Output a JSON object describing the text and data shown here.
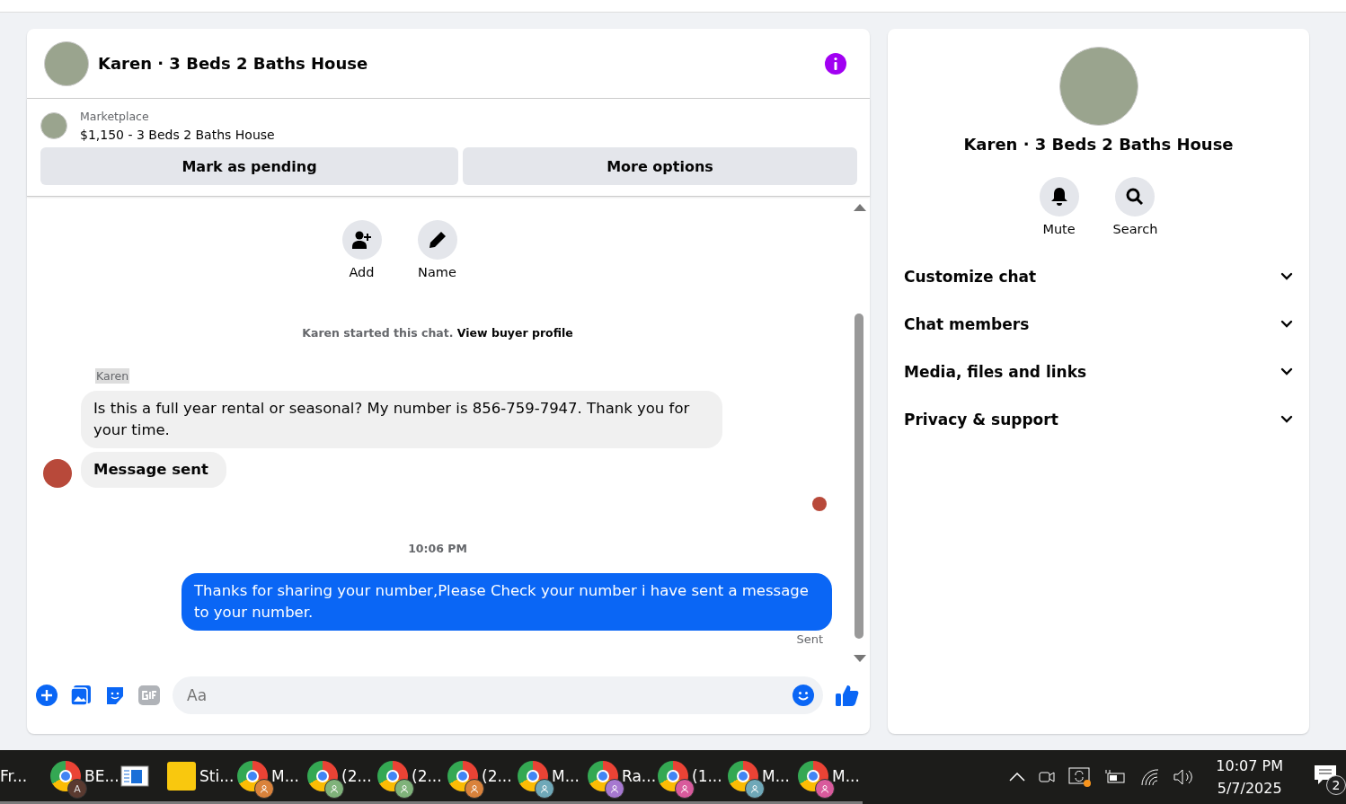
{
  "chat": {
    "title": "Karen · 3 Beds 2 Baths House",
    "listing": {
      "source": "Marketplace",
      "summary": "$1,150 - 3 Beds 2 Baths House"
    },
    "actions": [
      "Mark as pending",
      "More options"
    ],
    "quick_actions": [
      {
        "label": "Add",
        "kind": "add-person"
      },
      {
        "label": "Name",
        "kind": "edit"
      }
    ],
    "notice": {
      "text": "Karen started this chat.",
      "link": "View buyer profile"
    },
    "messages": [
      {
        "kind": "sender",
        "text": "Karen"
      },
      {
        "kind": "incoming",
        "text": "Is this a full year rental or seasonal? My number is 856-759-7947. Thank you for your time.",
        "avatar": false
      },
      {
        "kind": "incoming",
        "text": "Message sent",
        "avatar": true
      },
      {
        "kind": "seen"
      },
      {
        "kind": "time",
        "text": "10:06 PM"
      },
      {
        "kind": "outgoing",
        "text": "Thanks for sharing your number,Please Check your number i have sent a message to your number."
      },
      {
        "kind": "status",
        "text": "Sent"
      }
    ],
    "composer": {
      "placeholder": "Aa"
    }
  },
  "details": {
    "title": "Karen · 3 Beds 2 Baths House",
    "actions": [
      {
        "label": "Mute",
        "kind": "bell"
      },
      {
        "label": "Search",
        "kind": "search"
      }
    ],
    "sections": [
      "Customize chat",
      "Chat members",
      "Media, files and links",
      "Privacy & support"
    ]
  },
  "taskbar": {
    "apps": [
      {
        "kind": "text",
        "label": "Fr..."
      },
      {
        "kind": "chrome",
        "label": "BE...",
        "badge": "A",
        "color": "#5a3a30"
      },
      {
        "kind": "window"
      },
      {
        "kind": "sticky",
        "label": "Sti..."
      },
      {
        "kind": "chrome",
        "label": "M...",
        "color": "#d9823b"
      },
      {
        "kind": "chrome",
        "label": "(2...",
        "color": "#7fb27a"
      },
      {
        "kind": "chrome",
        "label": "(2...",
        "color": "#7fb27a"
      },
      {
        "kind": "chrome",
        "label": "(2...",
        "color": "#d9823b"
      },
      {
        "kind": "chrome",
        "label": "M...",
        "color": "#6fa8b8"
      },
      {
        "kind": "chrome",
        "label": "Ra...",
        "color": "#a678d0"
      },
      {
        "kind": "chrome",
        "label": "(1...",
        "color": "#d85a9c"
      },
      {
        "kind": "chrome",
        "label": "M...",
        "color": "#6fa8b8"
      },
      {
        "kind": "chrome",
        "label": "M...",
        "color": "#d85a9c"
      }
    ],
    "clock": {
      "time": "10:07 PM",
      "date": "5/7/2025"
    },
    "notifications": "2"
  }
}
